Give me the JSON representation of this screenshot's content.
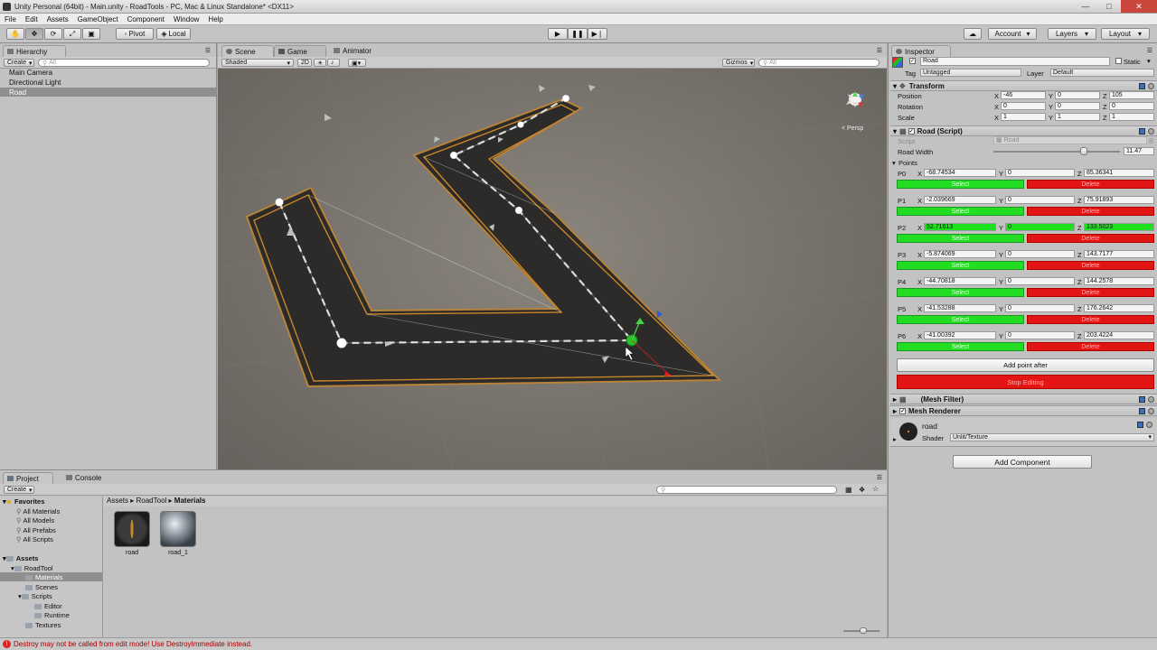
{
  "titlebar": {
    "title": "Unity Personal (64bit) - Main.unity - RoadTools - PC, Mac & Linux Standalone* <DX11>"
  },
  "menu": [
    "File",
    "Edit",
    "Assets",
    "GameObject",
    "Component",
    "Window",
    "Help"
  ],
  "toolbar": {
    "pivot": "Pivot",
    "local": "Local",
    "account": "Account",
    "layers": "Layers",
    "layout": "Layout"
  },
  "hierarchy": {
    "tab": "Hierarchy",
    "create": "Create",
    "search": "All",
    "items": [
      "Main Camera",
      "Directional Light",
      "Road"
    ]
  },
  "scene": {
    "tabs": [
      "Scene",
      "Game",
      "Animator"
    ],
    "shading": "Shaded",
    "mode2d": "2D",
    "gizmos": "Gizmos",
    "search": "All",
    "persp": "< Persp"
  },
  "inspector": {
    "tab": "Inspector",
    "name": "Road",
    "static": "Static",
    "tag_label": "Tag",
    "tag": "Untagged",
    "layer_label": "Layer",
    "layer": "Default",
    "transform": {
      "title": "Transform",
      "rows": [
        {
          "label": "Position",
          "x": "-46",
          "y": "0",
          "z": "105"
        },
        {
          "label": "Rotation",
          "x": "0",
          "y": "0",
          "z": "0"
        },
        {
          "label": "Scale",
          "x": "1",
          "y": "1",
          "z": "1"
        }
      ]
    },
    "script": {
      "title": "Road (Script)",
      "script_label": "Script",
      "script_value": "Road",
      "width_label": "Road Width",
      "width_value": "11.47",
      "width_fraction": 0.73,
      "points_label": "Points",
      "select": "Select",
      "delete": "Delete",
      "points": [
        {
          "label": "P0",
          "x": "-68.74534",
          "y": "0",
          "z": "85.36341"
        },
        {
          "label": "P1",
          "x": "-2.039669",
          "y": "0",
          "z": "75.91893"
        },
        {
          "label": "P2",
          "x": "52.71613",
          "y": "0",
          "z": "133.5023"
        },
        {
          "label": "P3",
          "x": "-5.874069",
          "y": "0",
          "z": "143.7177"
        },
        {
          "label": "P4",
          "x": "-44.70818",
          "y": "0",
          "z": "144.2578"
        },
        {
          "label": "P5",
          "x": "-41.53288",
          "y": "0",
          "z": "176.2642"
        },
        {
          "label": "P6",
          "x": "-41.00392",
          "y": "0",
          "z": "203.4224"
        }
      ],
      "add_point": "Add point after",
      "stop_editing": "Stop Editing"
    },
    "mesh_filter": "(Mesh Filter)",
    "mesh_renderer": "Mesh Renderer",
    "material": "road",
    "shader_label": "Shader",
    "shader": "Unlit/Texture",
    "add_component": "Add Component"
  },
  "project": {
    "tabs": [
      "Project",
      "Console"
    ],
    "create": "Create",
    "favorites": "Favorites",
    "fav_items": [
      "All Materials",
      "All Models",
      "All Prefabs",
      "All Scripts"
    ],
    "assets": "Assets",
    "tree": [
      "RoadTool",
      "Materials",
      "Scenes",
      "Scripts",
      "Editor",
      "Runtime",
      "Textures"
    ],
    "breadcrumb": [
      "Assets",
      "RoadTool",
      "Materials"
    ],
    "files": [
      "road",
      "road_1"
    ]
  },
  "status": {
    "error": "Destroy may not be called from edit mode! Use DestroyImmediate instead."
  },
  "colors": {
    "green": "#22dd22",
    "red": "#e31414",
    "road": "#2c2c2c",
    "road_edge": "#c8862a",
    "selected": "#8f8f8f"
  }
}
